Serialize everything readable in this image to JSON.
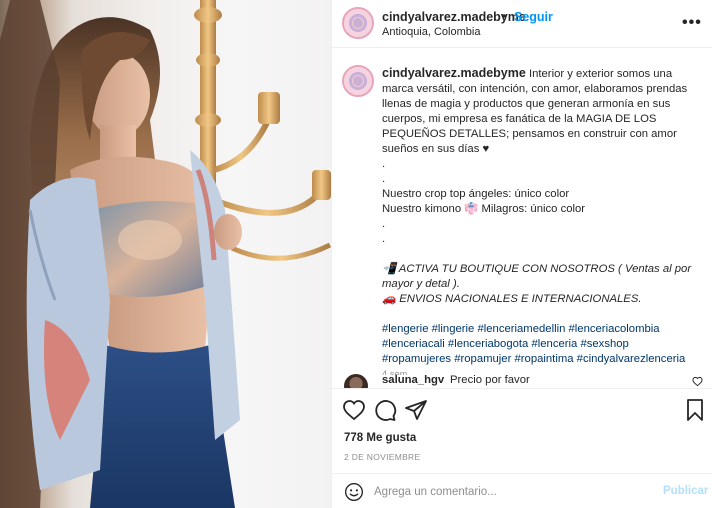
{
  "post": {
    "image_alt": "Woman in a printed crop top and kimono with candelabra in background"
  },
  "header": {
    "username": "cindyalvarez.madebyme",
    "separator": "•",
    "follow_label": "Seguir",
    "location": "Antioquia, Colombia",
    "more_icon": "more-horizontal-icon",
    "more_label": "•••"
  },
  "caption": {
    "username": "cindyalvarez.madebyme",
    "text": "Interior y exterior somos una marca versátil, con intención, con amor, elaboramos prendas llenas de magia y productos que generan armonía en sus cuerpos, mi empresa es fanática de la MAGIA DE LOS PEQUEÑOS DETALLES; pensamos en construir con amor sueños en sus días ♥",
    "dot1": ".",
    "dot2": ".",
    "line_crop": "Nuestro crop top ángeles: único color",
    "line_kimono": "Nuestro kimono 👘 Milagros: único color",
    "dot3": ".",
    "dot4": ".",
    "boutique": "📲 ACTIVA TU BOUTIQUE CON NOSOTROS ( Ventas al por mayor y detal ).",
    "envios": "🚗 ENVIOS NACIONALES E INTERNACIONALES.",
    "hashtags": "#lengerie #lingerie #lenceriamedellin #lenceriacolombia #lenceriacali #lenceriabogota #lenceria #sexshop #ropamujeres #ropamujer #ropaintima #cindyalvarezlenceria",
    "time_ago": "4 sem"
  },
  "comment": {
    "username": "saluna_hgv",
    "text": "Precio por favor"
  },
  "actions": {
    "icons": [
      "heart-icon",
      "comment-icon",
      "share-icon",
      "bookmark-icon"
    ]
  },
  "likes": {
    "label": "778 Me gusta"
  },
  "date": "2 DE NOVIEMBRE",
  "add_comment": {
    "placeholder": "Agrega un comentario...",
    "publish_label": "Publicar"
  }
}
